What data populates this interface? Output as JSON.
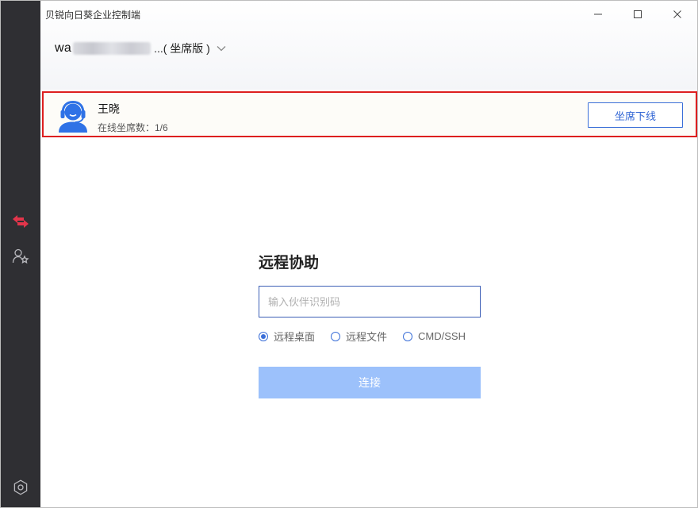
{
  "window": {
    "title": "贝锐向日葵企业控制端"
  },
  "account": {
    "name_prefix": "wa",
    "name_suffix": "...( 坐席版 )"
  },
  "agent": {
    "name": "王晓",
    "seats": "在线坐席数：1/6",
    "offline_button": "坐席下线"
  },
  "remote": {
    "title": "远程协助",
    "input_placeholder": "输入伙伴识别码",
    "modes": [
      {
        "label": "远程桌面",
        "selected": true
      },
      {
        "label": "远程文件",
        "selected": false
      },
      {
        "label": "CMD/SSH",
        "selected": false
      }
    ],
    "connect_label": "连接"
  },
  "colors": {
    "rail": "#2f2f33",
    "accent": "#3b6fd8",
    "active_icon": "#e2354b",
    "highlight_border": "#dd1f1f",
    "connect_disabled": "#9cc1fb"
  },
  "icons": {
    "rail_top": "remote-control-icon",
    "rail_middle": "contacts-star-icon",
    "rail_bottom": "settings-icon"
  }
}
